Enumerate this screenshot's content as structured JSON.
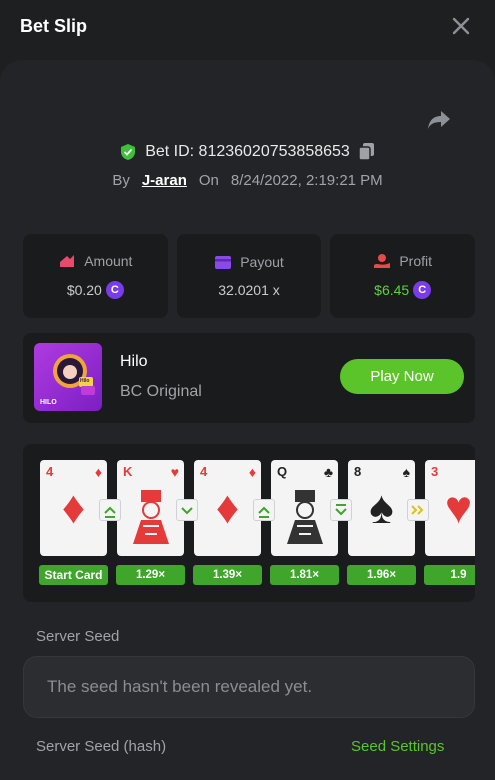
{
  "header": {
    "title": "Bet Slip"
  },
  "bet": {
    "id_text": "Bet ID: 81236020753858653",
    "by_label": "By",
    "user": "J-aran",
    "on_label": "On",
    "datetime": "8/24/2022, 2:19:21 PM"
  },
  "stats": {
    "amount": {
      "label": "Amount",
      "value": "$0.20"
    },
    "payout": {
      "label": "Payout",
      "value": "32.0201 x"
    },
    "profit": {
      "label": "Profit",
      "value": "$6.45"
    },
    "coin_glyph": "C"
  },
  "game": {
    "name": "Hilo",
    "provider": "BC Original",
    "play_label": "Play Now",
    "thumb_text": "HILO",
    "thumb_badge": "Hilo"
  },
  "round": {
    "cards": [
      {
        "rank": "4",
        "suit": "♦",
        "color": "red",
        "label": "Start Card"
      },
      {
        "rank": "K",
        "suit": "♥",
        "color": "red",
        "label": "1.29×"
      },
      {
        "rank": "4",
        "suit": "♦",
        "color": "red",
        "label": "1.39×"
      },
      {
        "rank": "Q",
        "suit": "♣",
        "color": "blk",
        "label": "1.81×"
      },
      {
        "rank": "8",
        "suit": "♠",
        "color": "blk",
        "label": "1.96×"
      },
      {
        "rank": "3",
        "suit": "♥",
        "color": "red",
        "label": "1.9"
      }
    ],
    "guesses": [
      "higher",
      "lower",
      "higher",
      "lower-or-same",
      "skip"
    ]
  },
  "seed": {
    "server_seed_label": "Server Seed",
    "server_seed_value": "The seed hasn't been revealed yet.",
    "hash_label": "Server Seed (hash)",
    "settings_label": "Seed Settings"
  },
  "colors": {
    "accent": "#5bc42b",
    "panel": "#232427",
    "card_bg": "#1a1b1d",
    "coin": "#7a3ce8"
  }
}
